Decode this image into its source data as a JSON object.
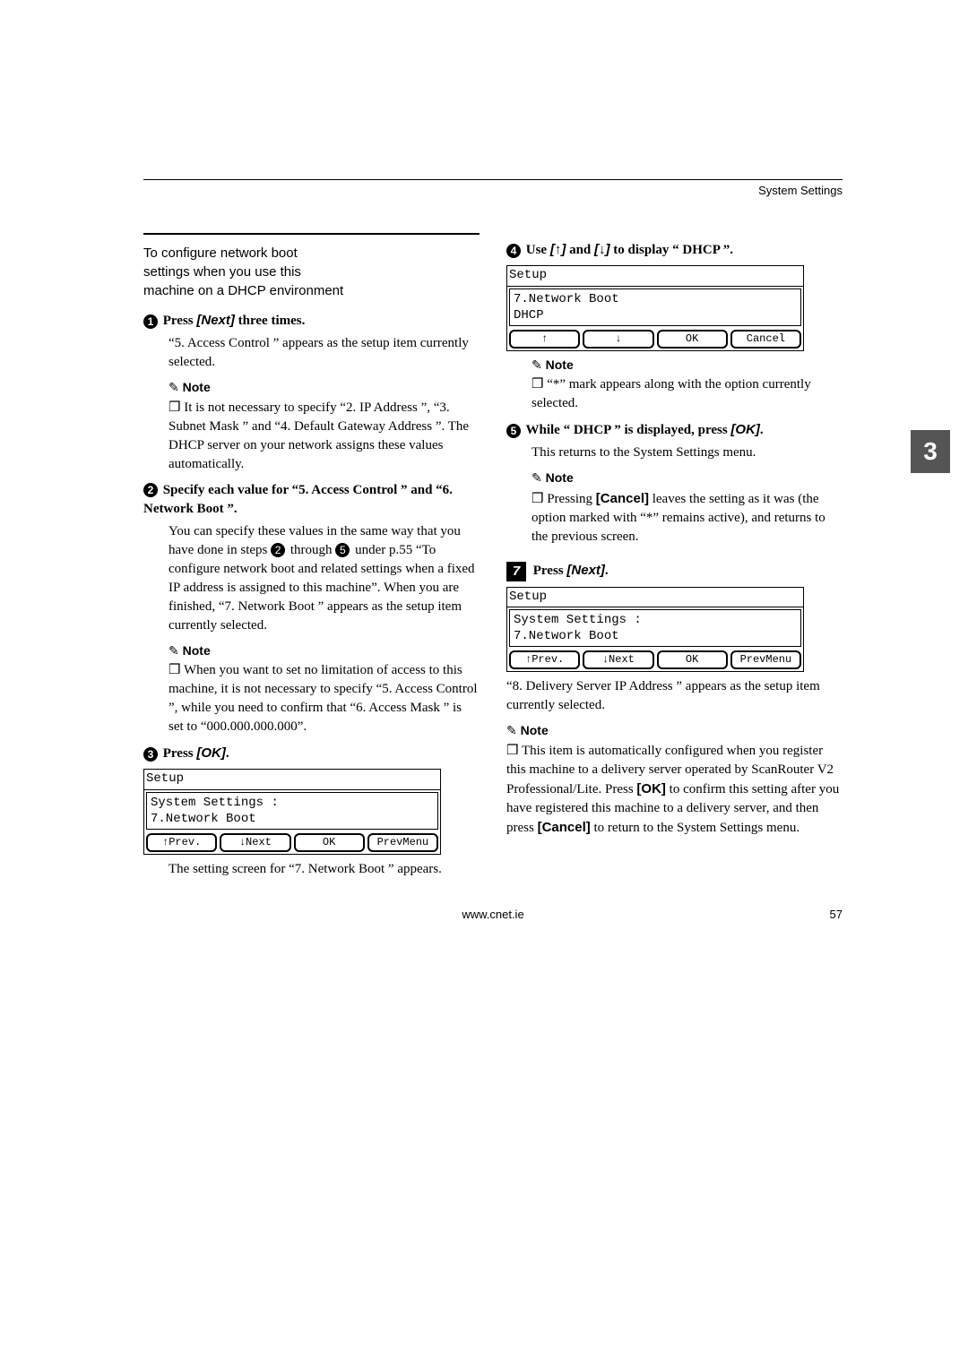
{
  "header_right": "System Settings",
  "left": {
    "section_title_l1": "To configure network boot",
    "section_title_l2": "settings when you use this",
    "section_title_l3": "machine on a DHCP environment",
    "s1": {
      "num": "1",
      "head_pre": "Press ",
      "head_key": "[Next]",
      "head_post": " three times.",
      "body": "“5. Access Control ” appears as the setup item currently selected.",
      "note_label": "Note",
      "note_body": "It is not necessary to specify “2. IP Address ”, “3. Subnet Mask ” and “4. Default Gateway Address ”. The DHCP server on your network assigns these values automatically."
    },
    "s2": {
      "num": "2",
      "head": "Specify each value for “5. Access Control ” and “6. Network Boot ”.",
      "body_a": "You can specify these values in the same way that you have done in steps ",
      "body_b": " through ",
      "body_c": " under p.55 “To configure network boot and related settings when a fixed IP address is assigned to this machine”. When you are finished, “7. Network Boot ” appears as the setup item currently selected.",
      "ref1": "2",
      "ref2": "5",
      "note_label": "Note",
      "note_body": "When you want to set no limitation of access to this machine, it is not necessary to specify “5. Access Control ”, while you need to confirm that “6. Access Mask ” is set to “000.000.000.000”."
    },
    "s3": {
      "num": "3",
      "head_pre": "Press ",
      "head_key": "[OK]",
      "head_post": ".",
      "lcd": {
        "title": "Setup",
        "line1": "System Settings :",
        "line2": " 7.Network Boot",
        "btn1": "↑Prev.",
        "btn2": "↓Next",
        "btn3": "OK",
        "btn4": "PrevMenu"
      },
      "after": "The setting screen for “7. Network Boot ” appears."
    }
  },
  "right": {
    "s4": {
      "num": "4",
      "head_pre": "Use ",
      "head_key1": "[↑]",
      "head_mid": " and ",
      "head_key2": "[↓]",
      "head_post": " to display “ DHCP ”.",
      "lcd": {
        "title": "Setup",
        "line1": "7.Network Boot",
        "line2": " DHCP",
        "btn1": "↑",
        "btn2": "↓",
        "btn3": "OK",
        "btn4": "Cancel"
      },
      "note_label": "Note",
      "note_body": "“*” mark appears along with the option currently selected."
    },
    "s5": {
      "num": "5",
      "head_pre": "While “ DHCP ” is displayed, press ",
      "head_key": "[OK]",
      "head_post": ".",
      "body": "This returns to the System Settings menu.",
      "note_label": "Note",
      "note_body_a": "Pressing ",
      "note_key": "[Cancel]",
      "note_body_b": " leaves the setting as it was (the option marked with “*” remains active), and returns to the previous screen."
    },
    "s7": {
      "num": "7",
      "head_pre": "Press ",
      "head_key": "[Next]",
      "head_post": ".",
      "lcd": {
        "title": "Setup",
        "line1": "System Settings :",
        "line2": " 7.Network Boot",
        "btn1": "↑Prev.",
        "btn2": "↓Next",
        "btn3": "OK",
        "btn4": "PrevMenu"
      },
      "after": "“8. Delivery Server IP Address ” appears as the setup item currently selected.",
      "note_label": "Note",
      "note_body_a": "This item is automatically configured when you register this machine to a delivery server operated by ScanRouter V2 Professional/Lite. Press ",
      "note_key1": "[OK]",
      "note_body_b": " to confirm this setting after you have registered this machine to a delivery server, and then press ",
      "note_key2": "[Cancel]",
      "note_body_c": " to return to the System Settings menu."
    }
  },
  "side_tab": "3",
  "footer_left": "www.cnet.ie",
  "footer_right": "57"
}
